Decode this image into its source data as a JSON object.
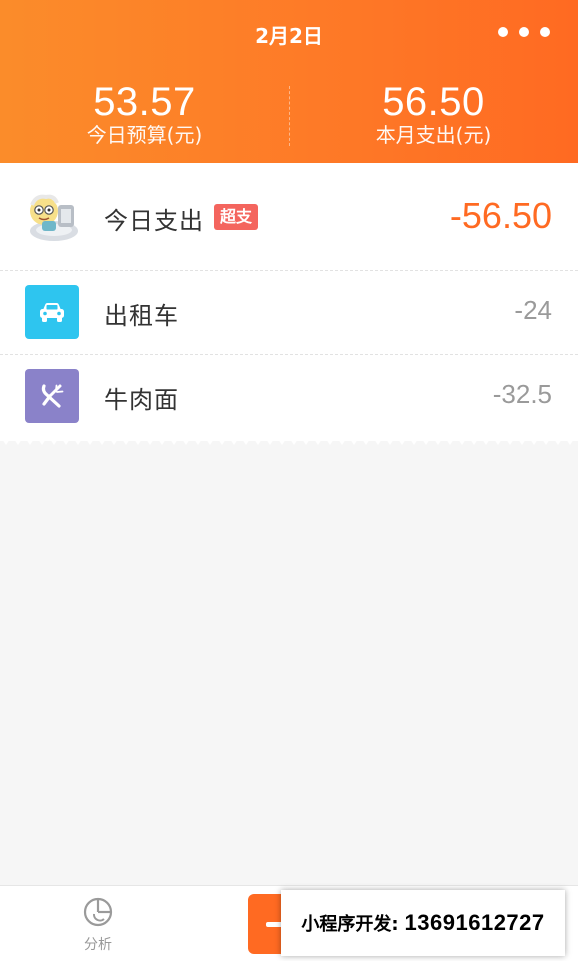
{
  "header": {
    "date": "2月2日",
    "more_icon": "more-dots-icon"
  },
  "stats": {
    "today_budget": {
      "value": "53.57",
      "label": "今日预算(元)"
    },
    "month_spend": {
      "value": "56.50",
      "label": "本月支出(元)"
    }
  },
  "summary": {
    "label": "今日支出",
    "badge": "超支",
    "amount": "-56.50",
    "avatar_icon": "cartoon-avatar-icon"
  },
  "items": [
    {
      "label": "出租车",
      "amount": "-24",
      "icon": "car-icon",
      "color": "#2ec5ef"
    },
    {
      "label": "牛肉面",
      "amount": "-32.5",
      "icon": "utensils-icon",
      "color": "#8a82c9"
    }
  ],
  "tabbar": {
    "analysis_label": "分析",
    "analysis_icon": "pie-chart-icon",
    "add_icon": "plus-icon"
  },
  "overlay": {
    "label": "小程序开发:",
    "phone": "13691612727"
  },
  "colors": {
    "accent": "#ff6a22",
    "header_gradient_start": "#fb8c2a",
    "badge": "#f4655e"
  }
}
